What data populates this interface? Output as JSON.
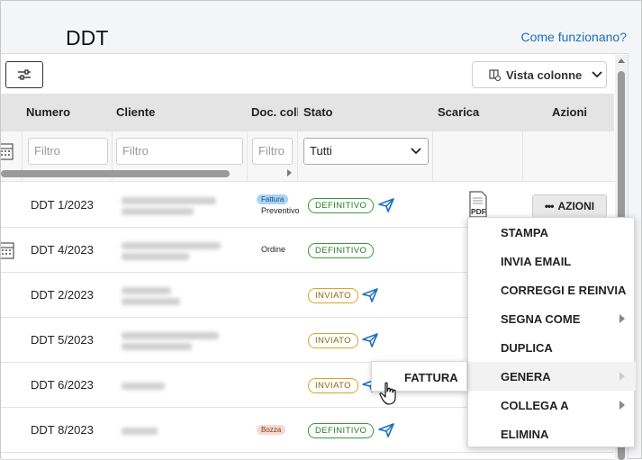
{
  "page": {
    "title": "DDT",
    "help_link": "Come funzionano?"
  },
  "toolbar": {
    "column_view_label": "Vista colonne"
  },
  "table": {
    "columns": [
      "Numero",
      "Cliente",
      "Doc. coll",
      "Stato",
      "Scarica",
      "Azioni"
    ],
    "filters": {
      "numero_placeholder": "Filtro",
      "cliente_placeholder": "Filtro",
      "doc_placeholder": "Filtro",
      "stato_value": "Tutti"
    },
    "rows": [
      {
        "numero": "DDT 1/2023",
        "doc_tag": "Fattura",
        "doc_text": "Preventivo",
        "stato": "DEFINITIVO",
        "pdf": "PDF",
        "azioni": "AZIONI"
      },
      {
        "numero": "DDT 4/2023",
        "doc_tag": "",
        "doc_text": "Ordine",
        "stato": "DEFINITIVO"
      },
      {
        "numero": "DDT 2/2023",
        "doc_tag": "",
        "doc_text": "",
        "stato": "INVIATO"
      },
      {
        "numero": "DDT 5/2023",
        "doc_tag": "",
        "doc_text": "",
        "stato": "INVIATO"
      },
      {
        "numero": "DDT 6/2023",
        "doc_tag": "",
        "doc_text": "",
        "stato": "INVIATO"
      },
      {
        "numero": "DDT 8/2023",
        "doc_tag": "Bozza",
        "doc_text": "",
        "stato": "DEFINITIVO"
      }
    ]
  },
  "actions_menu": {
    "items": [
      "STAMPA",
      "INVIA EMAIL",
      "CORREGGI E REINVIA",
      "SEGNA COME",
      "DUPLICA",
      "GENERA",
      "COLLEGA A",
      "ELIMINA"
    ]
  },
  "generate_submenu": {
    "items": [
      "FATTURA"
    ]
  },
  "colors": {
    "accent": "#1a6fc1",
    "definitivo": "#3a9a3a",
    "inviato": "#d9a32a",
    "fattura_tag": "#a9d4f5",
    "bozza_tag": "#f7d9cf"
  },
  "icons": {
    "filter_toggle": "sliders-icon",
    "column_view": "columns-icon",
    "send": "paper-plane-icon",
    "download": "pdf-file-icon",
    "calendar": "calendar-icon"
  }
}
